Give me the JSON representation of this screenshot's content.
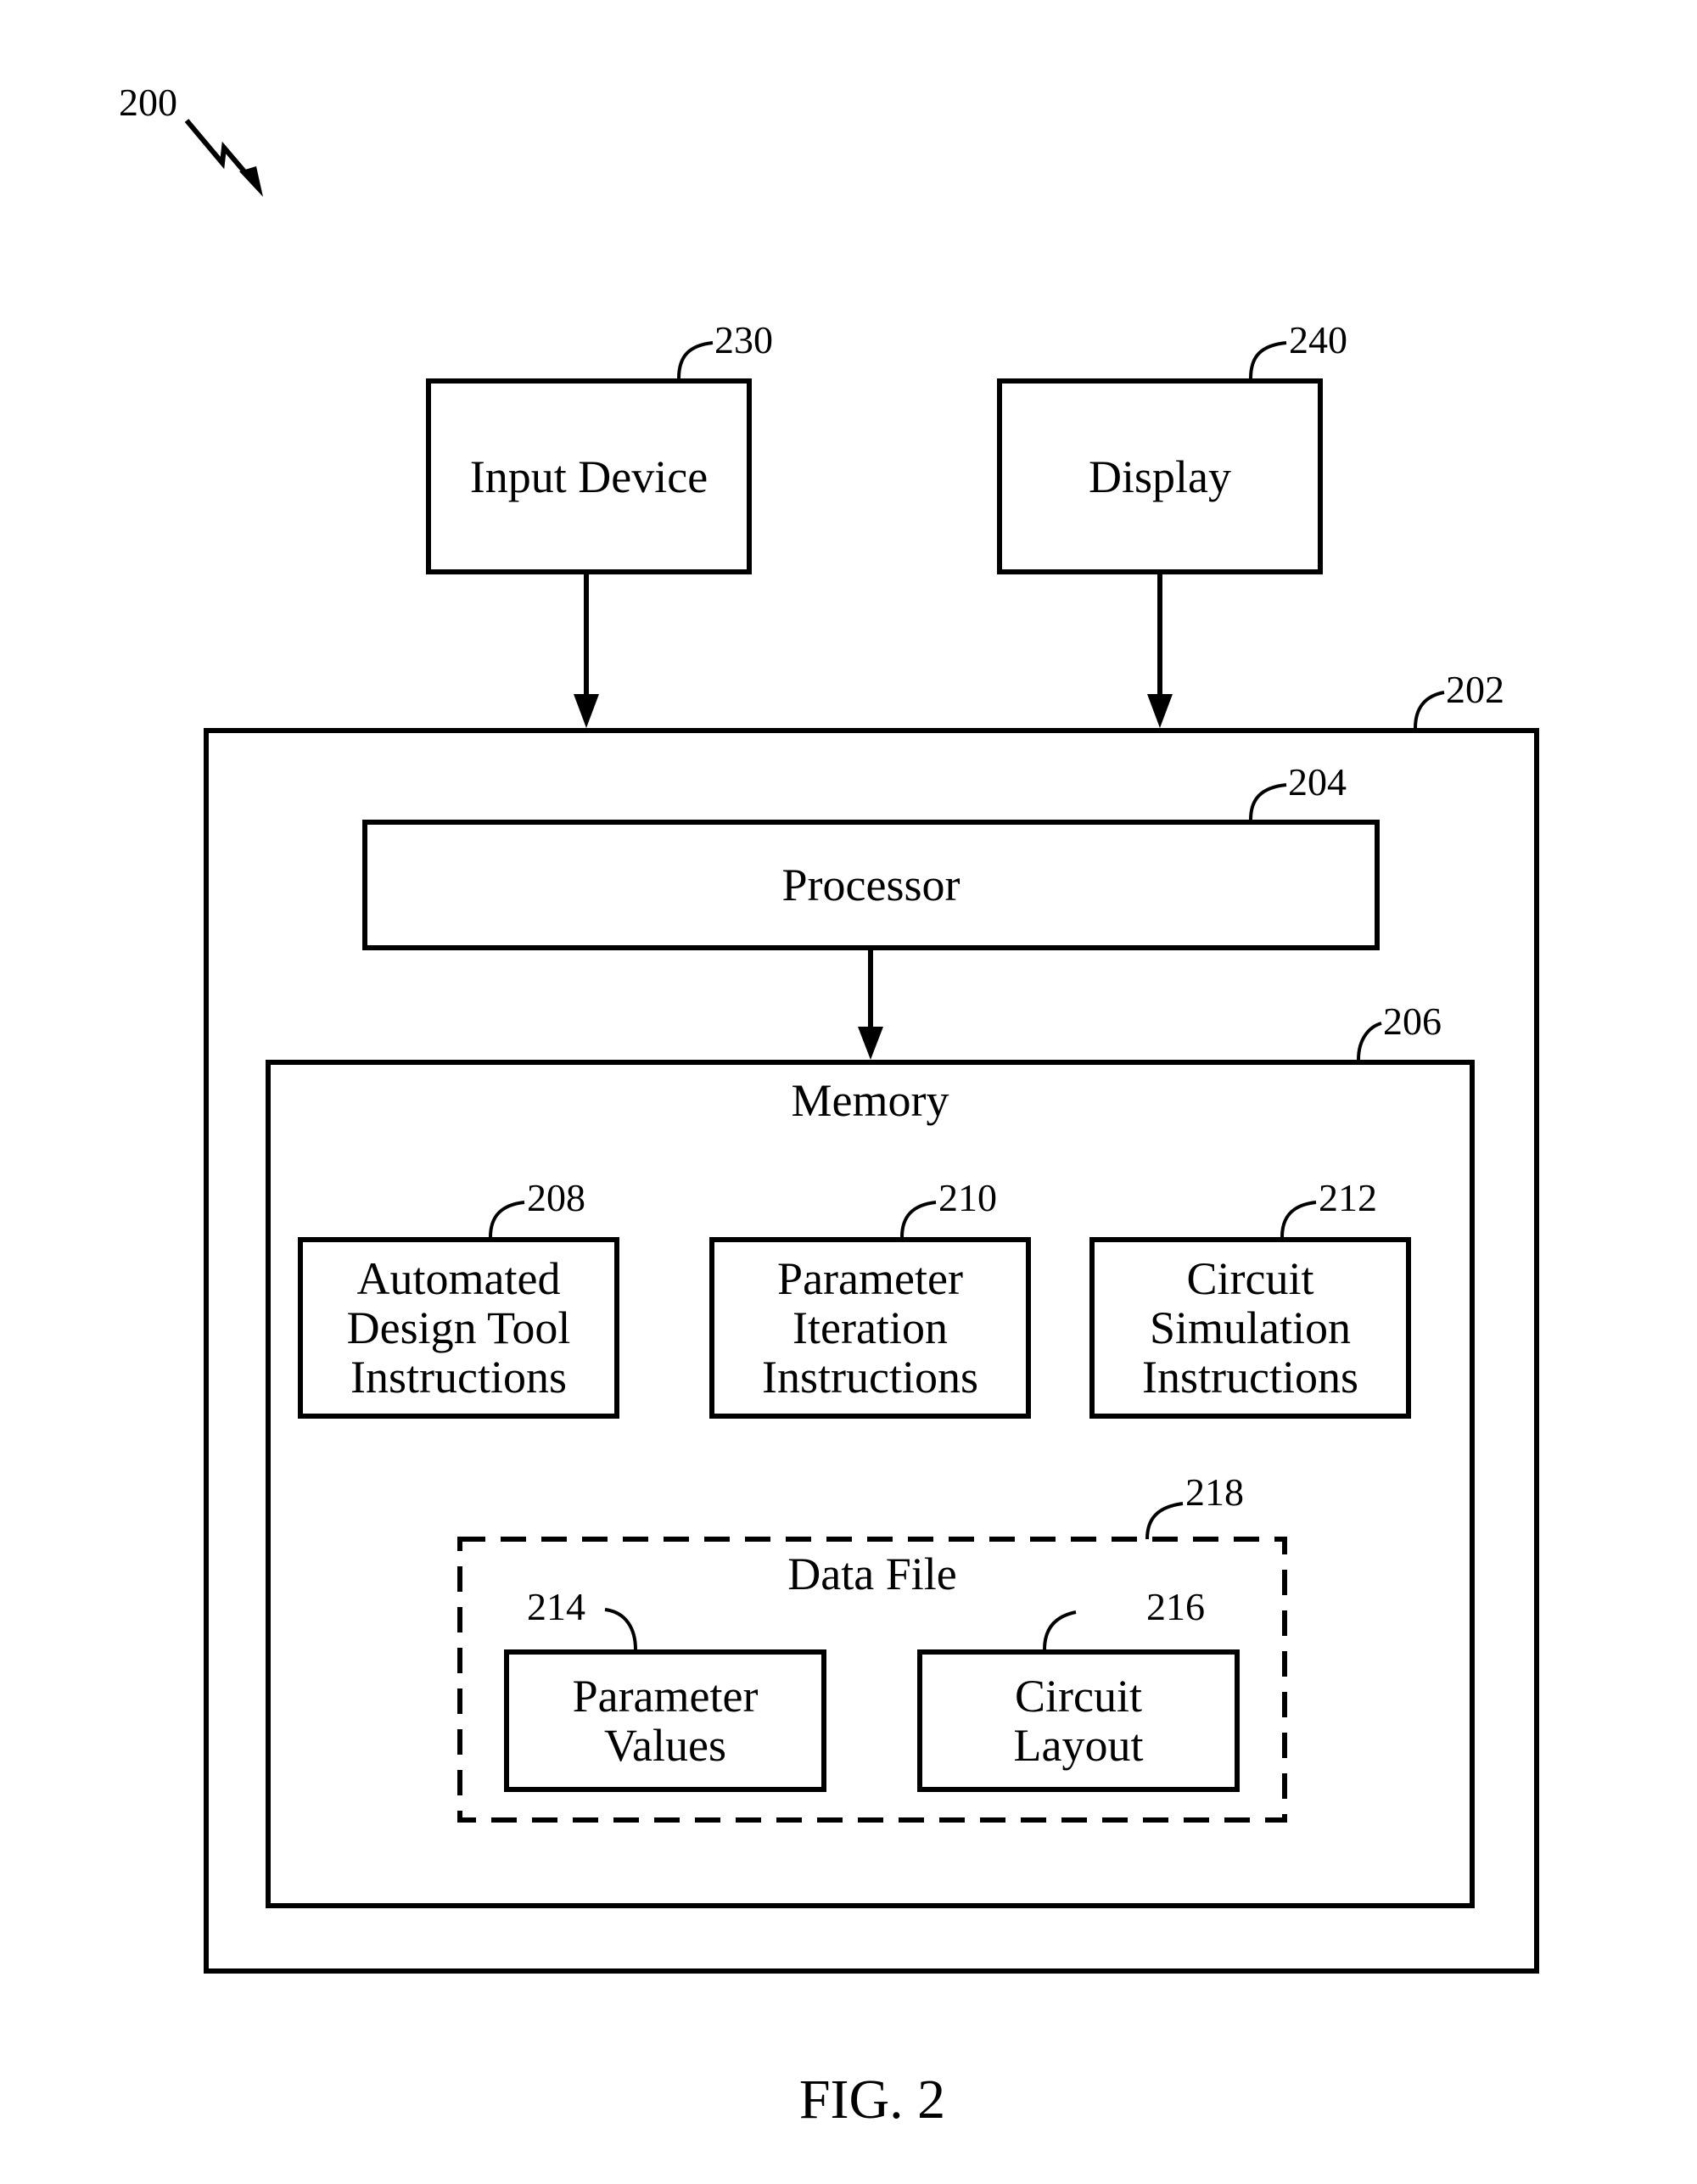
{
  "figure": {
    "reference": "200",
    "caption": "FIG. 2"
  },
  "components": {
    "input_device": {
      "ref": "230",
      "label": "Input Device"
    },
    "display": {
      "ref": "240",
      "label": "Display"
    },
    "computer": {
      "ref": "202"
    },
    "processor": {
      "ref": "204",
      "label": "Processor"
    },
    "memory": {
      "ref": "206",
      "label": "Memory"
    },
    "automated_design_tool": {
      "ref": "208",
      "label": "Automated\nDesign Tool\nInstructions"
    },
    "parameter_iteration": {
      "ref": "210",
      "label": "Parameter\nIteration\nInstructions"
    },
    "circuit_simulation": {
      "ref": "212",
      "label": "Circuit\nSimulation\nInstructions"
    },
    "data_file": {
      "ref": "218",
      "label": "Data File"
    },
    "parameter_values": {
      "ref": "214",
      "label": "Parameter\nValues"
    },
    "circuit_layout": {
      "ref": "216",
      "label": "Circuit\nLayout"
    }
  },
  "connections": [
    {
      "from": "Input Device",
      "to": "Computer 202"
    },
    {
      "from": "Display",
      "to": "Computer 202"
    },
    {
      "from": "Processor",
      "to": "Memory"
    }
  ]
}
